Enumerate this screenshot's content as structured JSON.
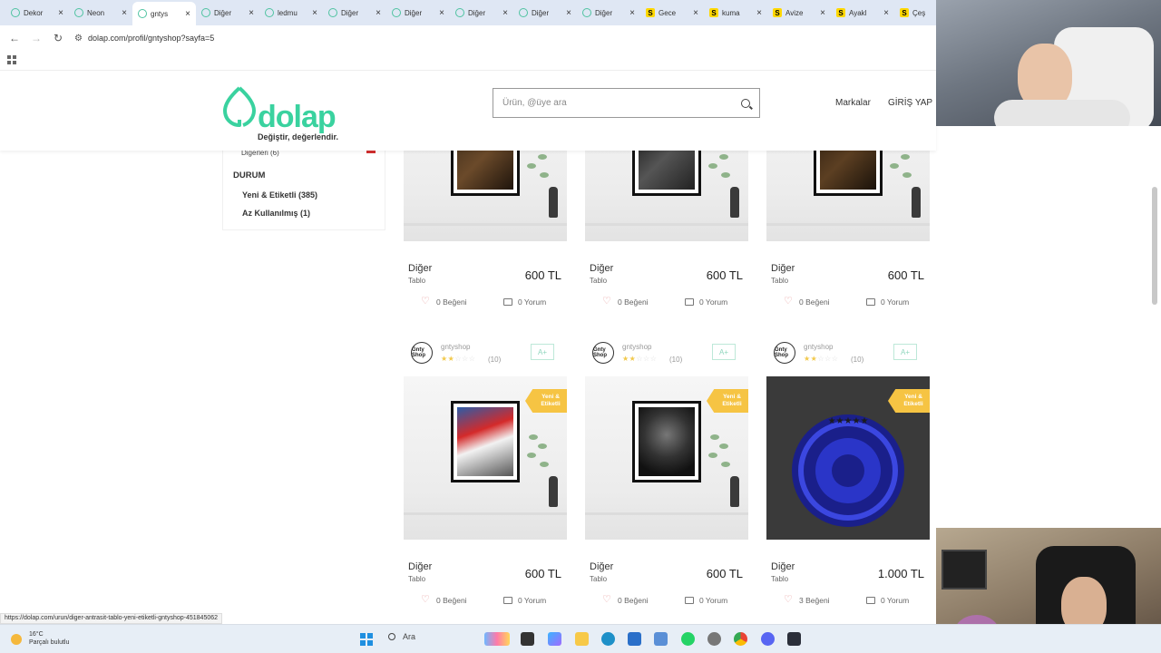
{
  "browser": {
    "tabs": [
      {
        "label": "Dekor",
        "icon": "circle-icon",
        "active": false
      },
      {
        "label": "Neon",
        "icon": "circle-icon",
        "active": false
      },
      {
        "label": "gntys",
        "icon": "circle-icon",
        "active": true
      },
      {
        "label": "Diğer",
        "icon": "circle-icon",
        "active": false
      },
      {
        "label": "ledmu",
        "icon": "circle-icon",
        "active": false
      },
      {
        "label": "Diğer",
        "icon": "circle-icon",
        "active": false
      },
      {
        "label": "Diğer",
        "icon": "circle-icon",
        "active": false
      },
      {
        "label": "Diğer",
        "icon": "circle-icon",
        "active": false
      },
      {
        "label": "Diğer",
        "icon": "circle-icon",
        "active": false
      },
      {
        "label": "Diğer",
        "icon": "circle-icon",
        "active": false
      },
      {
        "label": "Gece",
        "icon": "s-icon",
        "active": false
      },
      {
        "label": "kuma",
        "icon": "s-icon",
        "active": false
      },
      {
        "label": "Avize",
        "icon": "s-icon",
        "active": false
      },
      {
        "label": "Ayakl",
        "icon": "s-icon",
        "active": false
      },
      {
        "label": "Çeş",
        "icon": "s-icon",
        "active": false
      }
    ],
    "url": "dolap.com/profil/gntyshop?sayfa=5",
    "status_url": "https://dolap.com/urun/diger-antrasit-tablo-yeni-etiketli-gntyshop-451845062"
  },
  "header": {
    "logo_word": "dolap",
    "logo_tagline": "Değiştir, değerlendir.",
    "search_placeholder": "Ürün, @üye ara",
    "nav_brands": "Markalar",
    "nav_login": "GİRİŞ YAP",
    "brand_color": "#3ad29f"
  },
  "filters": {
    "cut_label": "Diğerleri (6)",
    "section_title": "DURUM",
    "options": [
      "Yeni & Etiketli (385)",
      "Az Kullanılmış (1)"
    ]
  },
  "products_top_row": [
    {
      "category": "Diğer",
      "sub": "Tablo",
      "price": "600 TL",
      "likes": "0 Beğeni",
      "comments": "0 Yorum"
    },
    {
      "category": "Diğer",
      "sub": "Tablo",
      "price": "600 TL",
      "likes": "0 Beğeni",
      "comments": "0 Yorum"
    },
    {
      "category": "Diğer",
      "sub": "Tablo",
      "price": "600 TL",
      "likes": "0 Beğeni",
      "comments": "0 Yorum"
    }
  ],
  "products_bottom_row": [
    {
      "seller": "gntyshop",
      "rating_count": "(10)",
      "badge": "Yeni & Etiketli",
      "follow": "A+",
      "category": "Diğer",
      "sub": "Tablo",
      "price": "600 TL",
      "likes": "0 Beğeni",
      "comments": "0 Yorum",
      "rating": 2
    },
    {
      "seller": "gntyshop",
      "rating_count": "(10)",
      "badge": "Yeni & Etiketli",
      "follow": "A+",
      "category": "Diğer",
      "sub": "Tablo",
      "price": "600 TL",
      "likes": "0 Beğeni",
      "comments": "0 Yorum",
      "rating": 2
    },
    {
      "seller": "gntyshop",
      "rating_count": "(10)",
      "badge": "Yeni & Etiketli",
      "follow": "A+",
      "category": "Diğer",
      "sub": "Tablo",
      "price": "1.000 TL",
      "likes": "3 Beğeni",
      "comments": "0 Yorum",
      "rating": 2
    }
  ],
  "avatar_text": "Gnty Shop",
  "taskbar": {
    "temperature": "16°C",
    "weather_text": "Parçalı bulutlu",
    "search_label": "Ara"
  }
}
